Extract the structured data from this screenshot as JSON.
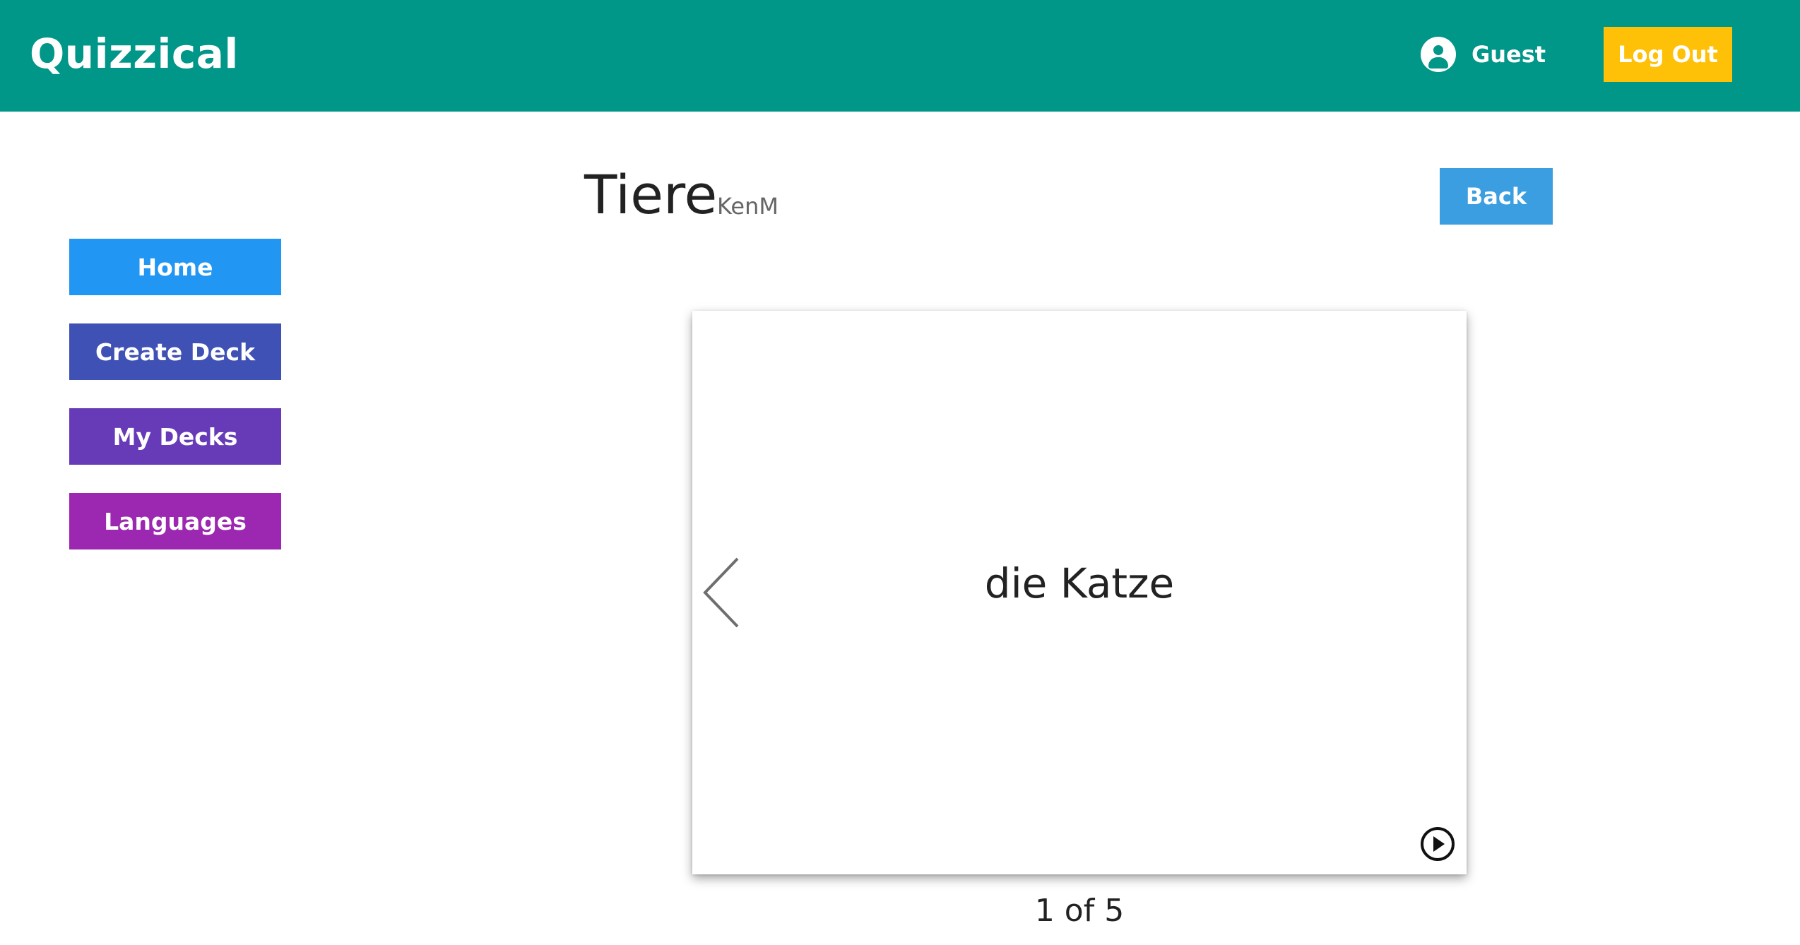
{
  "header": {
    "brand": "Quizzical",
    "user_icon": "user-circle-icon",
    "user_name": "Guest",
    "logout_label": "Log Out"
  },
  "sidebar": {
    "items": [
      {
        "label": "Home",
        "color": "#2196f3"
      },
      {
        "label": "Create Deck",
        "color": "#3f51b5"
      },
      {
        "label": "My Decks",
        "color": "#673ab7"
      },
      {
        "label": "Languages",
        "color": "#9c27b0"
      }
    ]
  },
  "deck": {
    "title": "Tiere",
    "author": "KenM",
    "back_label": "Back"
  },
  "card": {
    "word": "die Katze",
    "prev_icon": "chevron-left-icon",
    "play_icon": "play-circle-icon"
  },
  "progress": {
    "current": 1,
    "total": 5,
    "text": "1 of 5"
  },
  "colors": {
    "header_bg": "#009688",
    "logout_bg": "#ffc107",
    "back_bg": "#3a9ee0"
  }
}
